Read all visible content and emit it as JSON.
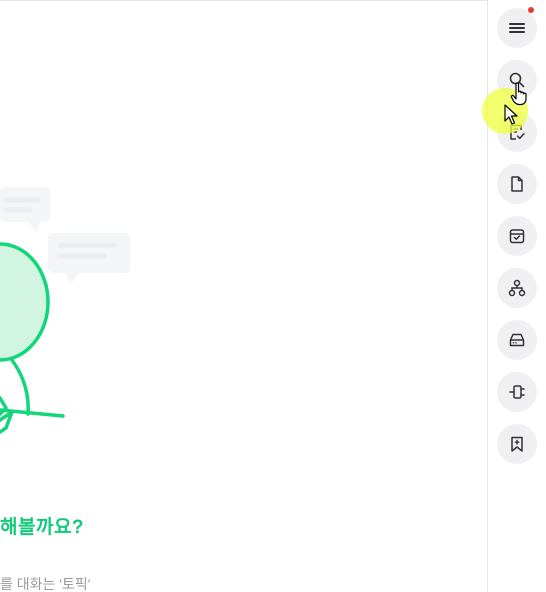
{
  "main": {
    "headline": "해볼까요?",
    "subtext": "를 대화는 '토픽'"
  },
  "sidebar": {
    "items": [
      {
        "name": "menu-button",
        "icon": "hamburger-icon",
        "badge": true
      },
      {
        "name": "search-button",
        "icon": "search-icon"
      },
      {
        "name": "tasks-button",
        "icon": "checklist-document-icon"
      },
      {
        "name": "files-button",
        "icon": "file-icon"
      },
      {
        "name": "archive-button",
        "icon": "archive-box-icon"
      },
      {
        "name": "organization-button",
        "icon": "org-chart-icon"
      },
      {
        "name": "drive-button",
        "icon": "drive-icon"
      },
      {
        "name": "integrations-button",
        "icon": "connector-icon"
      },
      {
        "name": "bookmarks-button",
        "icon": "bookmark-icon"
      }
    ]
  },
  "colors": {
    "accent": "#11c97a",
    "badge": "#e53935",
    "button_bg": "#f0f0f3",
    "icon": "#333333"
  }
}
